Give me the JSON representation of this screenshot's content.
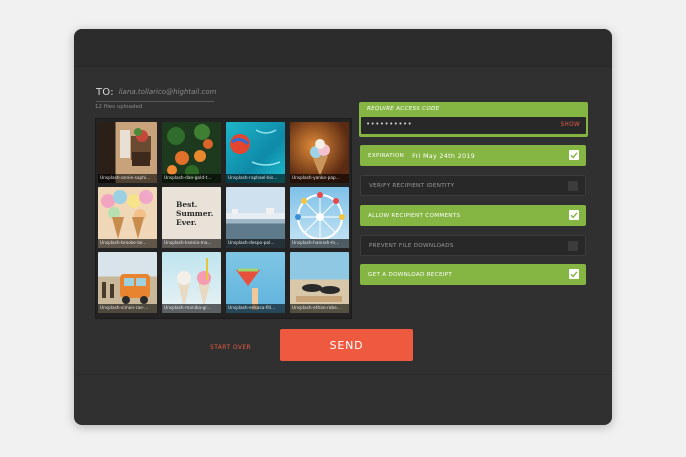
{
  "recipient": {
    "to_label": "TO:",
    "email": "liana.tollarico@hightail.com"
  },
  "files": {
    "count_text": "12 files uploaded",
    "items": [
      {
        "name": "Unsplash-annie-sophi..."
      },
      {
        "name": "Unsplash-dan-gold-t..."
      },
      {
        "name": "Unsplash-raphael-bis..."
      },
      {
        "name": "Unsplash-yanko-pap..."
      },
      {
        "name": "Unsplash-brooke-lar..."
      },
      {
        "name": "Unsplash-ksenia-ma..."
      },
      {
        "name": "Unsplash-despo-pol..."
      },
      {
        "name": "Unsplash-hannah-m..."
      },
      {
        "name": "Unsplash-simon-rae-..."
      },
      {
        "name": "Unsplash-monika-gr..."
      },
      {
        "name": "Unsplash-edsasa-fill..."
      },
      {
        "name": "Unsplash-ethan-robe..."
      }
    ],
    "poster_text_line1": "Best.",
    "poster_text_line2": "Summer.",
    "poster_text_line3": "Ever."
  },
  "access_code": {
    "label": "REQUIRE ACCESS CODE",
    "password_mask": "••••••••••",
    "show_label": "SHOW"
  },
  "options": {
    "expiration_label": "EXPIRATION",
    "expiration_date": "Fri May 24th 2019",
    "verify_label": "VERIFY RECIPIENT IDENTITY",
    "comments_label": "ALLOW RECIPIENT COMMENTS",
    "prevent_label": "PREVENT FILE DOWNLOADS",
    "receipt_label": "GET A DOWNLOAD RECEIPT"
  },
  "actions": {
    "start_over_label": "START OVER",
    "send_label": "SEND"
  },
  "colors": {
    "accent_green": "#85b542",
    "accent_red": "#ee5a40",
    "panel_bg": "#303030"
  }
}
